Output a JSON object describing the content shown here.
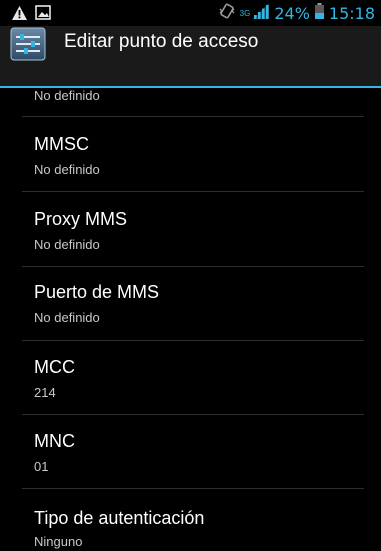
{
  "status_bar": {
    "network_type": "3G",
    "battery_percent": "24%",
    "time": "15:18",
    "icons": [
      "warning-icon",
      "image-icon",
      "vibrate-icon",
      "signal-icon",
      "battery-icon"
    ]
  },
  "action_bar": {
    "title": "Editar punto de acceso",
    "icon": "settings-sliders-icon"
  },
  "list": {
    "partial_top_value": "No definido",
    "items": [
      {
        "title": "MMSC",
        "value": "No definido"
      },
      {
        "title": "Proxy MMS",
        "value": "No definido"
      },
      {
        "title": "Puerto de MMS",
        "value": "No definido"
      },
      {
        "title": "MCC",
        "value": "214"
      },
      {
        "title": "MNC",
        "value": "01"
      },
      {
        "title": "Tipo de autenticación",
        "value": "Ninguno"
      }
    ]
  },
  "colors": {
    "accent": "#33b5e5",
    "background": "#000000",
    "action_bar": "#1a1a1a"
  }
}
